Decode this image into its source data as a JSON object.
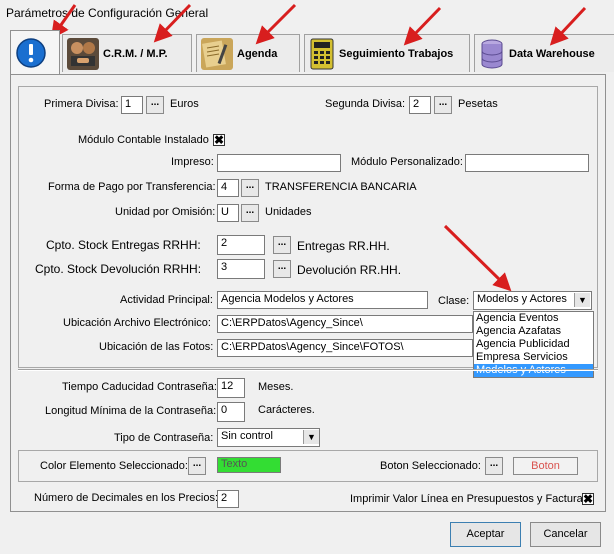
{
  "window": {
    "title": "Parámetros de Configuración General"
  },
  "tabs": [
    {
      "label": "",
      "icon": "info-icon"
    },
    {
      "label": "C.R.M. / M.P.",
      "icon": "handshake-icon"
    },
    {
      "label": "Agenda",
      "icon": "agenda-icon"
    },
    {
      "label": "Seguimiento Trabajos",
      "icon": "calculator-icon"
    },
    {
      "label": "Data Warehouse",
      "icon": "database-icon"
    }
  ],
  "form": {
    "primera_divisa": {
      "label": "Primera Divisa:",
      "value": "1",
      "desc": "Euros"
    },
    "segunda_divisa": {
      "label": "Segunda Divisa:",
      "value": "2",
      "desc": "Pesetas"
    },
    "modulo_contable": {
      "label": "Módulo Contable Instalado",
      "checked": "✖"
    },
    "impreso": {
      "label": "Impreso:",
      "value": ""
    },
    "modulo_personalizado": {
      "label": "Módulo Personalizado:",
      "value": ""
    },
    "forma_pago": {
      "label": "Forma de Pago por Transferencia:",
      "value": "4",
      "desc": "TRANSFERENCIA BANCARIA"
    },
    "unidad_omision": {
      "label": "Unidad por Omisión:",
      "value": "U",
      "desc": "Unidades"
    },
    "stock_entregas": {
      "label": "Cpto. Stock Entregas RRHH:",
      "value": "2",
      "desc": "Entregas RR.HH."
    },
    "stock_devolucion": {
      "label": "Cpto. Stock Devolución RRHH:",
      "value": "3",
      "desc": "Devolución RR.HH."
    },
    "actividad": {
      "label": "Actividad Principal:",
      "value": "Agencia Modelos y Actores"
    },
    "clase": {
      "label": "Clase:",
      "value": "Modelos y Actores",
      "options": [
        "Agencia Eventos",
        "Agencia Azafatas",
        "Agencia Publicidad",
        "Empresa Servicios",
        "Modelos y Actores"
      ]
    },
    "ubicacion_archivo": {
      "label": "Ubicación Archivo Electrónico:",
      "value": "C:\\ERPDatos\\Agency_Since\\"
    },
    "ubicacion_fotos": {
      "label": "Ubicación de las Fotos:",
      "value": "C:\\ERPDatos\\Agency_Since\\FOTOS\\"
    },
    "caducidad": {
      "label": "Tiempo Caducidad Contraseña:",
      "value": "12",
      "desc": "Meses."
    },
    "longitud": {
      "label": "Longitud Mínima de la Contraseña:",
      "value": "0",
      "desc": "Carácteres."
    },
    "tipo_contrasena": {
      "label": "Tipo de Contraseña:",
      "value": "Sin control"
    },
    "color_elemento": {
      "label": "Color Elemento Seleccionado:",
      "value": "Texto",
      "color": "#33dd33"
    },
    "boton_seleccionado": {
      "label": "Boton Seleccionado:",
      "value": "Boton",
      "color": "#d9534f"
    },
    "decimales": {
      "label": "Número de Decimales en los Precios:",
      "value": "2"
    },
    "imprimir_valor": {
      "label": "Imprimir Valor Línea en Presupuestos y Facturas",
      "checked": "✖"
    }
  },
  "buttons": {
    "ellipsis": "...",
    "aceptar": "Aceptar",
    "cancelar": "Cancelar"
  },
  "colors": {
    "highlight": "#3399ff",
    "annotation_arrow": "#d81e1e"
  }
}
